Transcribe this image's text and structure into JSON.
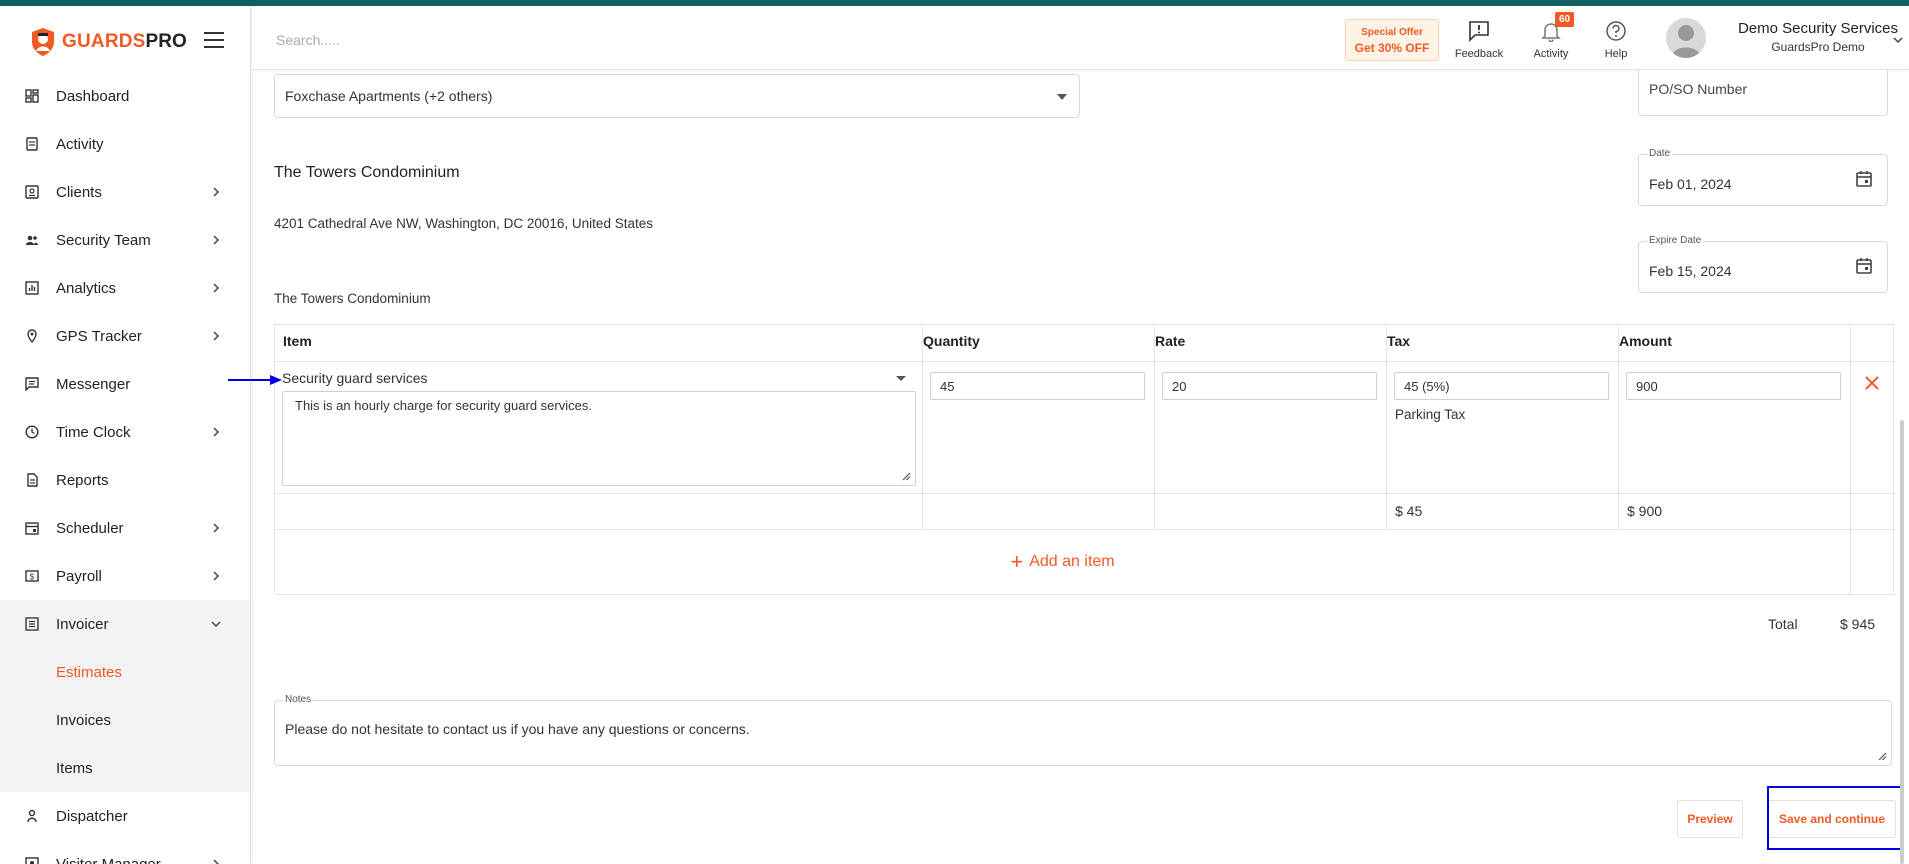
{
  "brand": {
    "name_part1": "GUARDS",
    "name_part2": "PRO"
  },
  "sidebar": {
    "items": [
      {
        "label": "Dashboard",
        "icon": "dashboard-icon",
        "chevron": false
      },
      {
        "label": "Activity",
        "icon": "activity-icon",
        "chevron": false
      },
      {
        "label": "Clients",
        "icon": "clients-icon",
        "chevron": true
      },
      {
        "label": "Security Team",
        "icon": "team-icon",
        "chevron": true
      },
      {
        "label": "Analytics",
        "icon": "analytics-icon",
        "chevron": true
      },
      {
        "label": "GPS Tracker",
        "icon": "location-pin-icon",
        "chevron": true
      },
      {
        "label": "Messenger",
        "icon": "message-icon",
        "chevron": false
      },
      {
        "label": "Time Clock",
        "icon": "clock-icon",
        "chevron": true
      },
      {
        "label": "Reports",
        "icon": "report-icon",
        "chevron": false
      },
      {
        "label": "Scheduler",
        "icon": "calendar-icon",
        "chevron": true
      },
      {
        "label": "Payroll",
        "icon": "payroll-icon",
        "chevron": true
      },
      {
        "label": "Invoicer",
        "icon": "invoice-icon",
        "chevron": true,
        "expanded": true
      },
      {
        "label": "Dispatcher",
        "icon": "dispatcher-icon",
        "chevron": false
      },
      {
        "label": "Visitor Manager",
        "icon": "visitor-icon",
        "chevron": true
      }
    ],
    "invoicer_sub": [
      {
        "label": "Estimates",
        "active": true
      },
      {
        "label": "Invoices",
        "active": false
      },
      {
        "label": "Items",
        "active": false
      }
    ]
  },
  "header": {
    "search_placeholder": "Search.....",
    "offer_line1": "Special Offer",
    "offer_line2": "Get 30% OFF",
    "feedback_label": "Feedback",
    "activity_label": "Activity",
    "activity_badge": "60",
    "help_label": "Help",
    "user_name": "Demo Security Services",
    "user_sub": "GuardsPro Demo"
  },
  "form": {
    "location_select": "Foxchase Apartments (+2 others)",
    "po_placeholder": "PO/SO Number",
    "date_label": "Date",
    "date_value": "Feb 01, 2024",
    "expire_label": "Expire Date",
    "expire_value": "Feb 15, 2024",
    "client_name": "The Towers Condominium",
    "client_address": "4201 Cathedral Ave NW, Washington, DC 20016, United States",
    "client_name_2": "The Towers Condominium"
  },
  "table": {
    "headers": [
      "Item",
      "Quantity",
      "Rate",
      "Tax",
      "Amount"
    ],
    "row": {
      "item": "Security guard services",
      "description": "This is an hourly charge for security guard services.",
      "quantity": "45",
      "rate": "20",
      "tax": "45 (5%)",
      "tax_name": "Parking Tax",
      "amount": "900"
    },
    "summary": {
      "tax": "$ 45",
      "amount": "$ 900"
    },
    "add_item": "Add an item"
  },
  "totals": {
    "label": "Total",
    "value": "$ 945"
  },
  "notes": {
    "label": "Notes",
    "value": "Please do not hesitate to contact us if you have any questions or concerns."
  },
  "actions": {
    "preview": "Preview",
    "save": "Save and continue"
  },
  "colors": {
    "accent": "#f15a24",
    "topbar": "#0f5f63",
    "highlight": "#0000e6"
  }
}
